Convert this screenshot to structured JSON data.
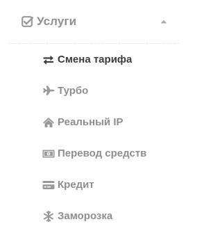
{
  "section": {
    "title": "Услуги",
    "icon": "check-square-icon",
    "toggle_icon": "caret-up-icon",
    "expanded": true
  },
  "colors": {
    "text_muted": "#8e8e8e",
    "text_active": "#3c3c3c",
    "icon_muted": "#999999",
    "icon_active": "#3c3c3c",
    "divider": "#e6e6e6"
  },
  "items": [
    {
      "label": "Смена тарифа",
      "icon": "exchange-icon",
      "active": true
    },
    {
      "label": "Турбо",
      "icon": "plane-icon",
      "active": false
    },
    {
      "label": "Реальный IP",
      "icon": "home-icon",
      "active": false
    },
    {
      "label": "Перевод средств",
      "icon": "money-icon",
      "active": false
    },
    {
      "label": "Кредит",
      "icon": "credit-card-icon",
      "active": false
    },
    {
      "label": "Заморозка",
      "icon": "snowflake-icon",
      "active": false
    }
  ]
}
